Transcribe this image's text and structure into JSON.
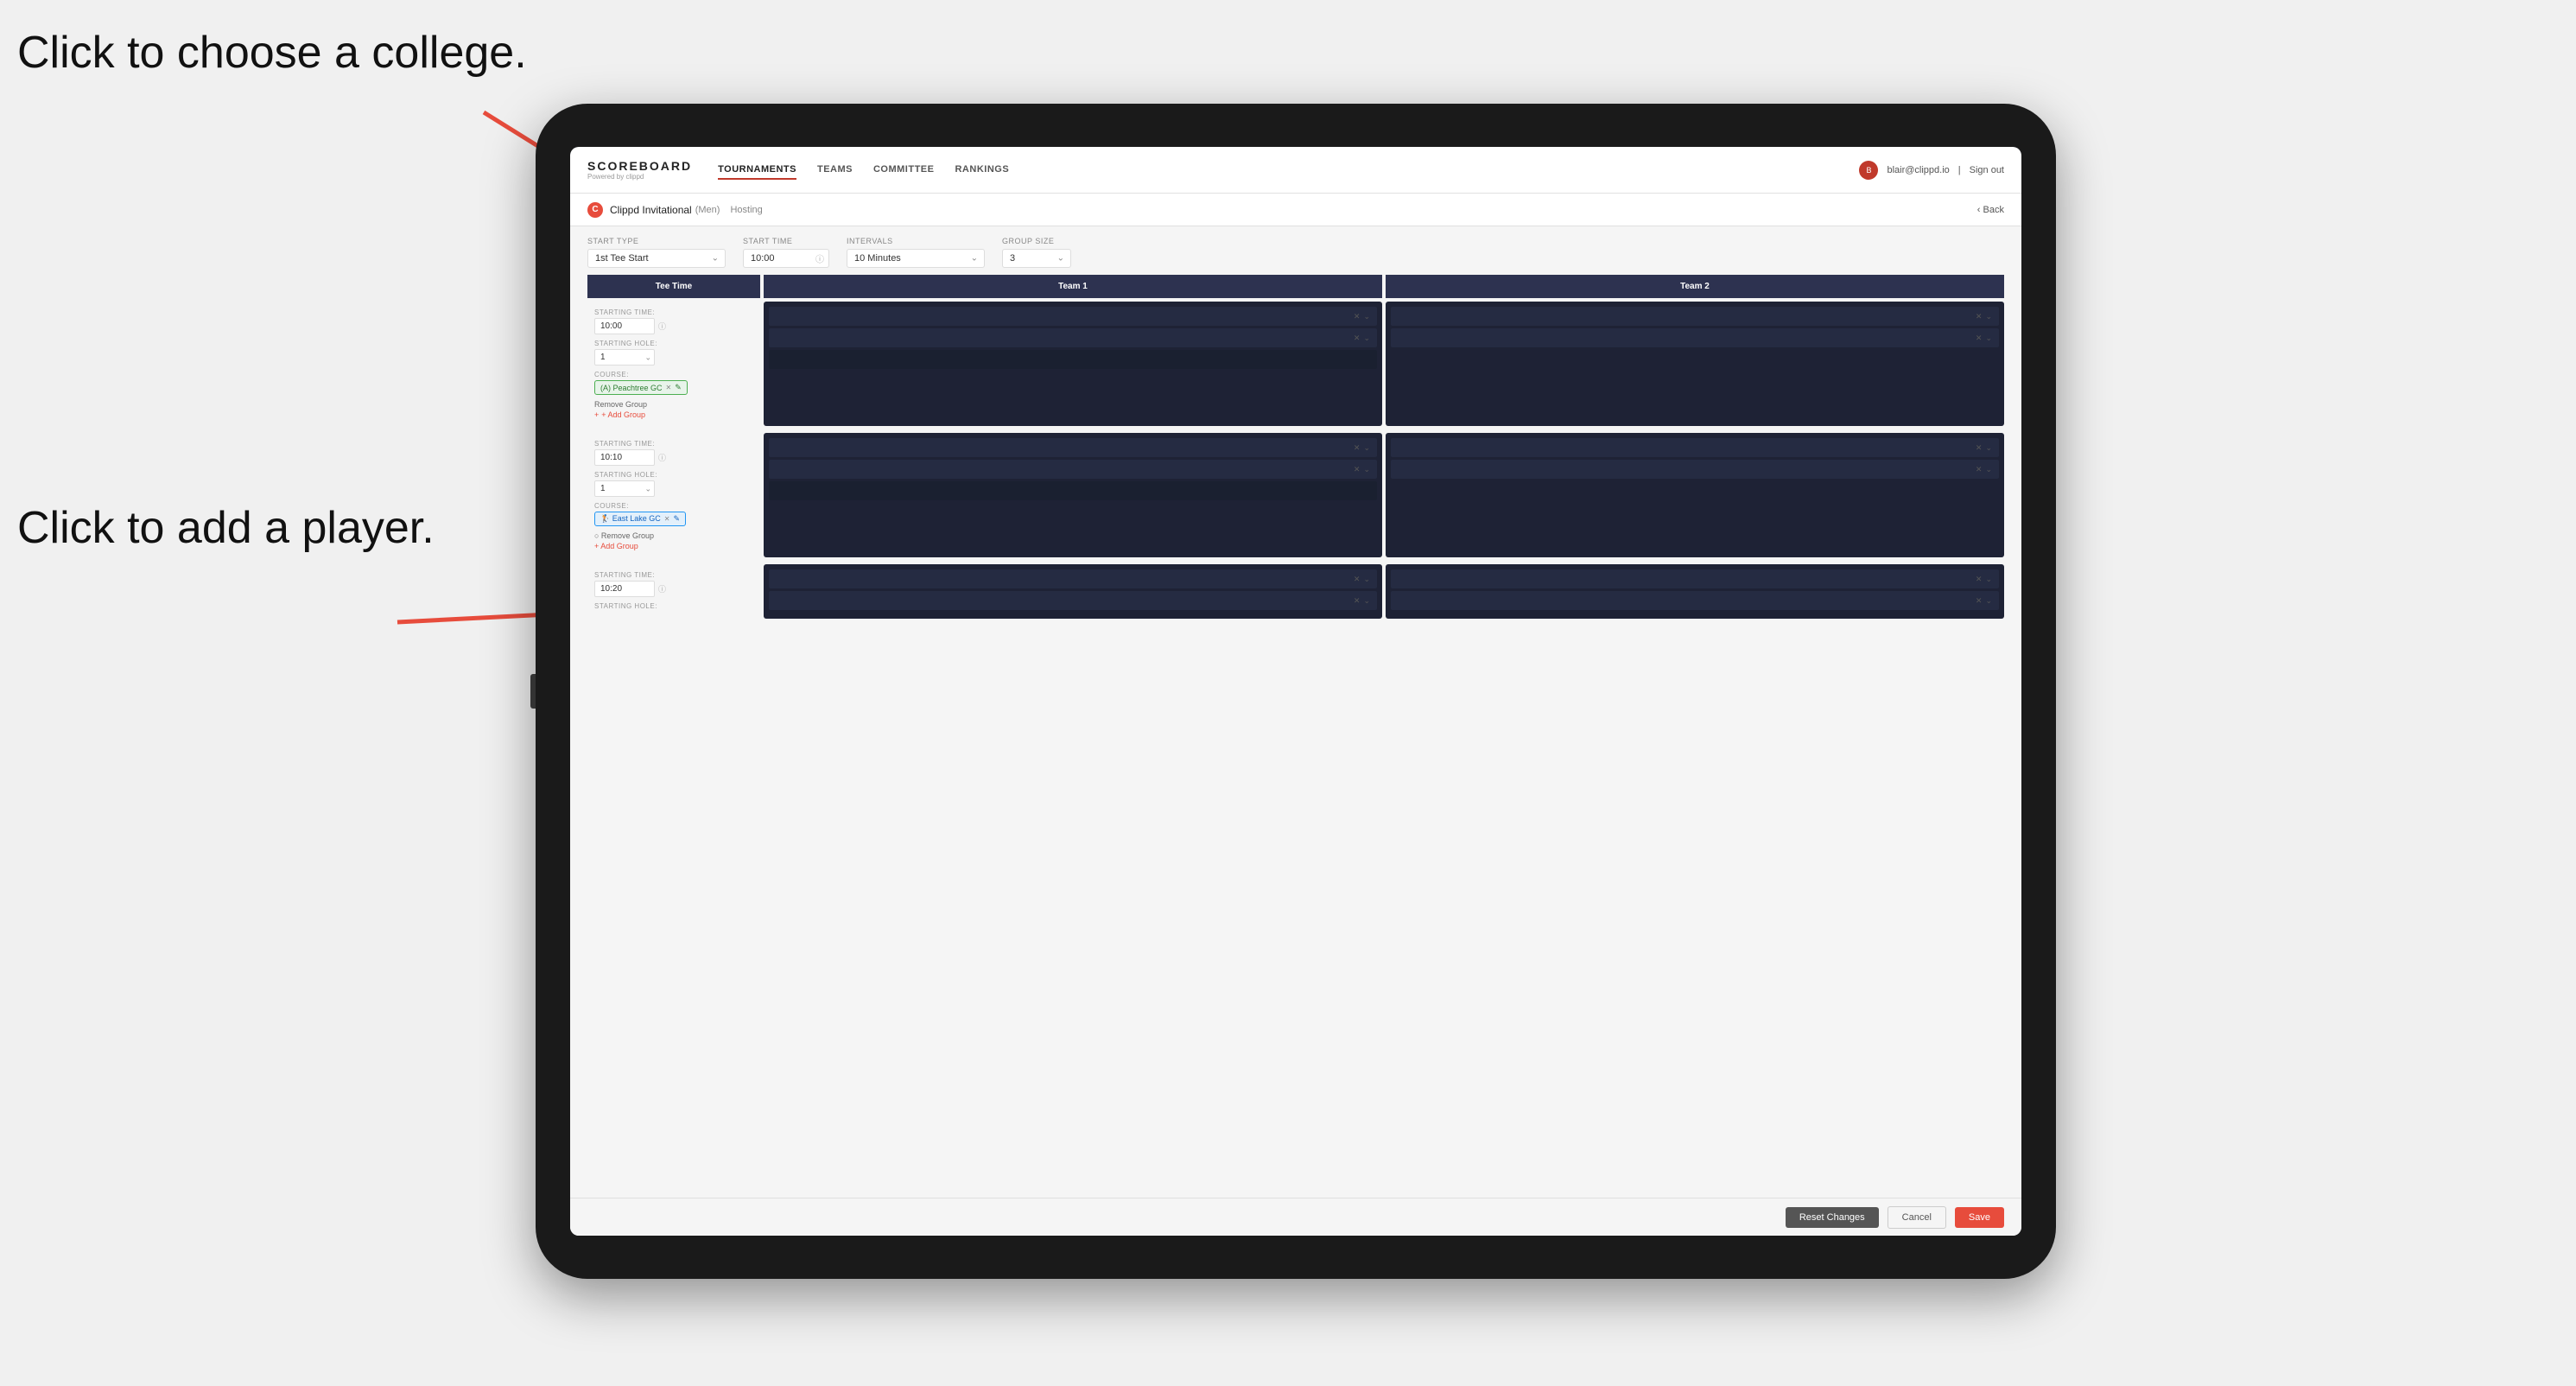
{
  "annotations": {
    "college": "Click to choose a\ncollege.",
    "player": "Click to add\na player."
  },
  "navbar": {
    "brand": "SCOREBOARD",
    "powered_by": "Powered by clippd",
    "nav_items": [
      "TOURNAMENTS",
      "TEAMS",
      "COMMITTEE",
      "RANKINGS"
    ],
    "active_nav": "TOURNAMENTS",
    "user_email": "blair@clippd.io",
    "sign_out": "Sign out"
  },
  "breadcrumb": {
    "logo": "C",
    "title": "Clippd Invitational",
    "gender": "(Men)",
    "hosting": "Hosting",
    "back": "Back"
  },
  "settings": {
    "start_type_label": "Start Type",
    "start_type_value": "1st Tee Start",
    "start_time_label": "Start Time",
    "start_time_value": "10:00",
    "intervals_label": "Intervals",
    "intervals_value": "10 Minutes",
    "group_size_label": "Group Size",
    "group_size_value": "3"
  },
  "table": {
    "col_tee_time": "Tee Time",
    "col_team1": "Team 1",
    "col_team2": "Team 2"
  },
  "groups": [
    {
      "starting_time": "10:00",
      "starting_hole": "1",
      "course": "(A) Peachtree GC",
      "players_team1": 2,
      "players_team2": 2,
      "has_add_team2": false
    },
    {
      "starting_time": "10:10",
      "starting_hole": "1",
      "course": "East Lake GC",
      "course_icon": "🏌",
      "players_team1": 2,
      "players_team2": 2,
      "has_add_team2": false
    },
    {
      "starting_time": "10:20",
      "starting_hole": "",
      "course": "",
      "players_team1": 2,
      "players_team2": 2,
      "has_add_team2": false
    }
  ],
  "actions": {
    "remove_group": "Remove Group",
    "add_group": "+ Add Group"
  },
  "footer": {
    "reset_label": "Reset Changes",
    "cancel_label": "Cancel",
    "save_label": "Save"
  }
}
